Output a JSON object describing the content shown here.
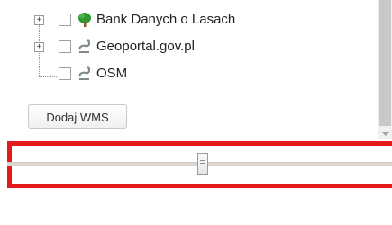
{
  "layer_tree": {
    "items": [
      {
        "label": "Bank Danych o Lasach",
        "expandable": true,
        "expander_symbol": "+",
        "checked": false,
        "icon": "tree-icon"
      },
      {
        "label": "Geoportal.gov.pl",
        "expandable": true,
        "expander_symbol": "+",
        "checked": false,
        "icon": "wms-layer-icon"
      },
      {
        "label": "OSM",
        "expandable": false,
        "checked": false,
        "icon": "wms-layer-icon"
      }
    ]
  },
  "add_wms_button": {
    "label": "Dodaj WMS"
  },
  "opacity_slider": {
    "value_fraction": 0.5
  },
  "colors": {
    "highlight": "#e31a1c",
    "tree_icon_green": "#2f9a2e",
    "layer_icon_gray": "#7f8a8c"
  }
}
